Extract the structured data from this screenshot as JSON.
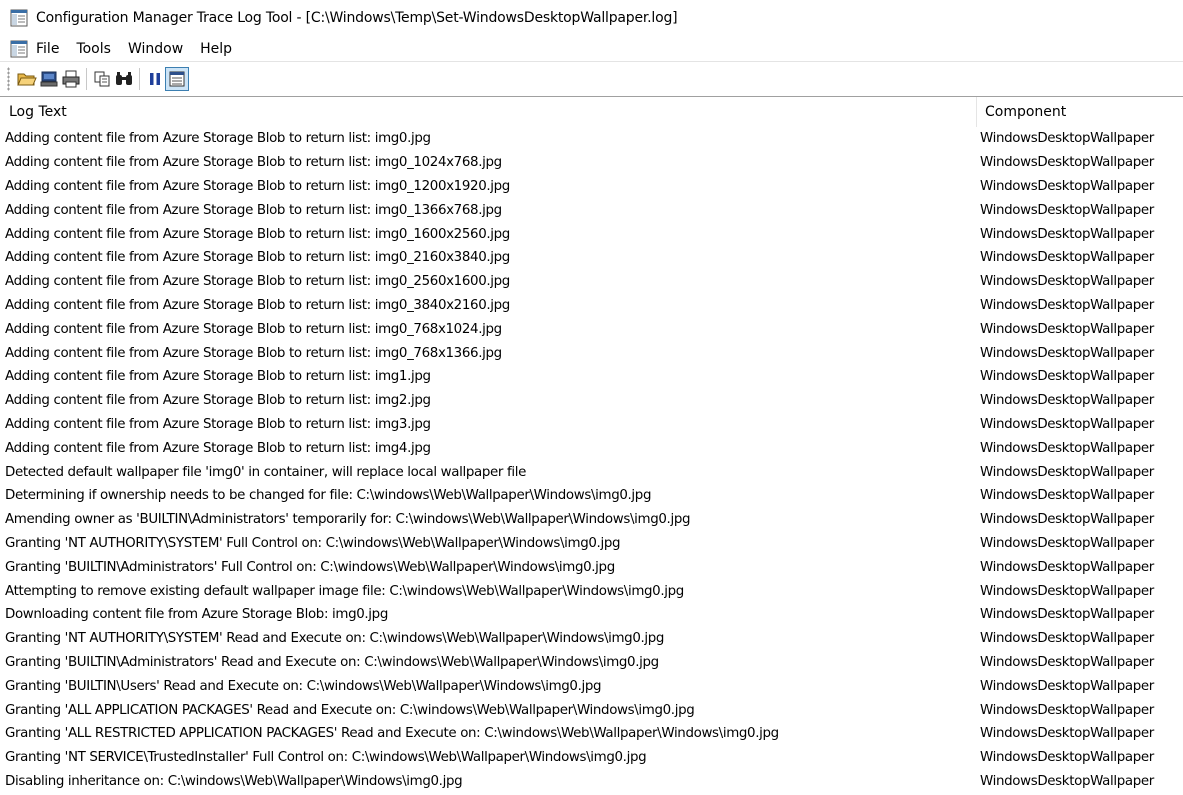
{
  "window": {
    "title": "Configuration Manager Trace Log Tool - [C:\\Windows\\Temp\\Set-WindowsDesktopWallpaper.log]",
    "app_icon": "cmtrace-icon"
  },
  "menubar": {
    "doc_icon": "document-icon",
    "items": [
      {
        "label": "File"
      },
      {
        "label": "Tools"
      },
      {
        "label": "Window"
      },
      {
        "label": "Help"
      }
    ]
  },
  "toolbar": {
    "buttons": [
      {
        "name": "open-folder-icon"
      },
      {
        "name": "open-server-icon"
      },
      {
        "name": "print-icon"
      },
      {
        "name": "copy-icon"
      },
      {
        "name": "find-icon"
      },
      {
        "name": "pause-icon"
      },
      {
        "name": "highlight-icon",
        "active": true
      }
    ]
  },
  "table": {
    "columns": [
      "Log Text",
      "Component"
    ],
    "rows": [
      {
        "log": "Adding content file from Azure Storage Blob to return list: img0.jpg",
        "component": "WindowsDesktopWallpaper"
      },
      {
        "log": "Adding content file from Azure Storage Blob to return list: img0_1024x768.jpg",
        "component": "WindowsDesktopWallpaper"
      },
      {
        "log": "Adding content file from Azure Storage Blob to return list: img0_1200x1920.jpg",
        "component": "WindowsDesktopWallpaper"
      },
      {
        "log": "Adding content file from Azure Storage Blob to return list: img0_1366x768.jpg",
        "component": "WindowsDesktopWallpaper"
      },
      {
        "log": "Adding content file from Azure Storage Blob to return list: img0_1600x2560.jpg",
        "component": "WindowsDesktopWallpaper"
      },
      {
        "log": "Adding content file from Azure Storage Blob to return list: img0_2160x3840.jpg",
        "component": "WindowsDesktopWallpaper"
      },
      {
        "log": "Adding content file from Azure Storage Blob to return list: img0_2560x1600.jpg",
        "component": "WindowsDesktopWallpaper"
      },
      {
        "log": "Adding content file from Azure Storage Blob to return list: img0_3840x2160.jpg",
        "component": "WindowsDesktopWallpaper"
      },
      {
        "log": "Adding content file from Azure Storage Blob to return list: img0_768x1024.jpg",
        "component": "WindowsDesktopWallpaper"
      },
      {
        "log": "Adding content file from Azure Storage Blob to return list: img0_768x1366.jpg",
        "component": "WindowsDesktopWallpaper"
      },
      {
        "log": "Adding content file from Azure Storage Blob to return list: img1.jpg",
        "component": "WindowsDesktopWallpaper"
      },
      {
        "log": "Adding content file from Azure Storage Blob to return list: img2.jpg",
        "component": "WindowsDesktopWallpaper"
      },
      {
        "log": "Adding content file from Azure Storage Blob to return list: img3.jpg",
        "component": "WindowsDesktopWallpaper"
      },
      {
        "log": "Adding content file from Azure Storage Blob to return list: img4.jpg",
        "component": "WindowsDesktopWallpaper"
      },
      {
        "log": "Detected default wallpaper file 'img0' in container, will replace local wallpaper file",
        "component": "WindowsDesktopWallpaper"
      },
      {
        "log": "Determining if ownership needs to be changed for file: C:\\windows\\Web\\Wallpaper\\Windows\\img0.jpg",
        "component": "WindowsDesktopWallpaper"
      },
      {
        "log": "Amending owner as 'BUILTIN\\Administrators' temporarily for: C:\\windows\\Web\\Wallpaper\\Windows\\img0.jpg",
        "component": "WindowsDesktopWallpaper"
      },
      {
        "log": "Granting 'NT AUTHORITY\\SYSTEM' Full Control on: C:\\windows\\Web\\Wallpaper\\Windows\\img0.jpg",
        "component": "WindowsDesktopWallpaper"
      },
      {
        "log": "Granting 'BUILTIN\\Administrators' Full Control on: C:\\windows\\Web\\Wallpaper\\Windows\\img0.jpg",
        "component": "WindowsDesktopWallpaper"
      },
      {
        "log": "Attempting to remove existing default wallpaper image file: C:\\windows\\Web\\Wallpaper\\Windows\\img0.jpg",
        "component": "WindowsDesktopWallpaper"
      },
      {
        "log": "Downloading content file from Azure Storage Blob: img0.jpg",
        "component": "WindowsDesktopWallpaper"
      },
      {
        "log": "Granting 'NT AUTHORITY\\SYSTEM' Read and Execute on: C:\\windows\\Web\\Wallpaper\\Windows\\img0.jpg",
        "component": "WindowsDesktopWallpaper"
      },
      {
        "log": "Granting 'BUILTIN\\Administrators' Read and Execute on: C:\\windows\\Web\\Wallpaper\\Windows\\img0.jpg",
        "component": "WindowsDesktopWallpaper"
      },
      {
        "log": "Granting 'BUILTIN\\Users' Read and Execute on: C:\\windows\\Web\\Wallpaper\\Windows\\img0.jpg",
        "component": "WindowsDesktopWallpaper"
      },
      {
        "log": "Granting 'ALL APPLICATION PACKAGES' Read and Execute on: C:\\windows\\Web\\Wallpaper\\Windows\\img0.jpg",
        "component": "WindowsDesktopWallpaper"
      },
      {
        "log": "Granting 'ALL RESTRICTED APPLICATION PACKAGES' Read and Execute on: C:\\windows\\Web\\Wallpaper\\Windows\\img0.jpg",
        "component": "WindowsDesktopWallpaper"
      },
      {
        "log": "Granting 'NT SERVICE\\TrustedInstaller' Full Control on: C:\\windows\\Web\\Wallpaper\\Windows\\img0.jpg",
        "component": "WindowsDesktopWallpaper"
      },
      {
        "log": "Disabling inheritance on: C:\\windows\\Web\\Wallpaper\\Windows\\img0.jpg",
        "component": "WindowsDesktopWallpaper"
      }
    ]
  }
}
